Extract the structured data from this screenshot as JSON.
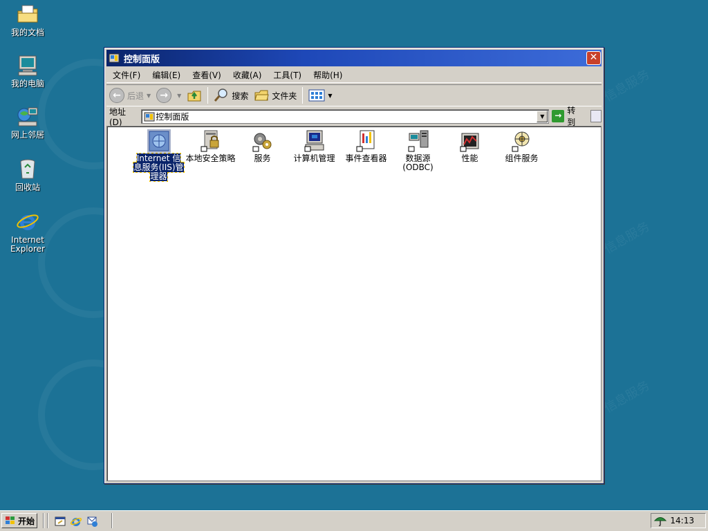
{
  "desktop": {
    "icons": [
      {
        "label": "我的文档",
        "icon": "my-documents-folder-icon"
      },
      {
        "label": "我的电脑",
        "icon": "my-computer-icon"
      },
      {
        "label": "网上邻居",
        "icon": "network-neighborhood-icon"
      },
      {
        "label": "回收站",
        "icon": "recycle-bin-icon"
      },
      {
        "label": "Internet Explorer",
        "icon": "internet-explorer-icon"
      }
    ],
    "watermark_text": "信息服务"
  },
  "window": {
    "title": "控制面版",
    "close_label": "✕",
    "menu": [
      {
        "label": "文件(F)"
      },
      {
        "label": "编辑(E)"
      },
      {
        "label": "查看(V)"
      },
      {
        "label": "收藏(A)"
      },
      {
        "label": "工具(T)"
      },
      {
        "label": "帮助(H)"
      }
    ],
    "toolbar": {
      "back_label": "后退",
      "search_label": "搜索",
      "folders_label": "文件夹"
    },
    "address": {
      "label": "地址(D)",
      "value": "控制面版",
      "go_label": "转到"
    },
    "items": [
      {
        "label": "Internet 信息服务(IIS)管理器",
        "icon": "iis-manager-icon",
        "selected": true
      },
      {
        "label": "本地安全策略",
        "icon": "local-security-policy-icon",
        "selected": false
      },
      {
        "label": "服务",
        "icon": "services-icon",
        "selected": false
      },
      {
        "label": "计算机管理",
        "icon": "computer-management-icon",
        "selected": false
      },
      {
        "label": "事件查看器",
        "icon": "event-viewer-icon",
        "selected": false
      },
      {
        "label": "数据源(ODBC)",
        "icon": "odbc-data-source-icon",
        "selected": false
      },
      {
        "label": "性能",
        "icon": "performance-icon",
        "selected": false
      },
      {
        "label": "组件服务",
        "icon": "component-services-icon",
        "selected": false
      }
    ]
  },
  "taskbar": {
    "start_label": "开始",
    "clock": "14:13"
  },
  "colors": {
    "desktop_bg": "#1c7296",
    "titlebar_start": "#0a246a",
    "titlebar_end": "#3d6cd9",
    "selection": "#0a246a",
    "close_button": "#c8402a"
  }
}
